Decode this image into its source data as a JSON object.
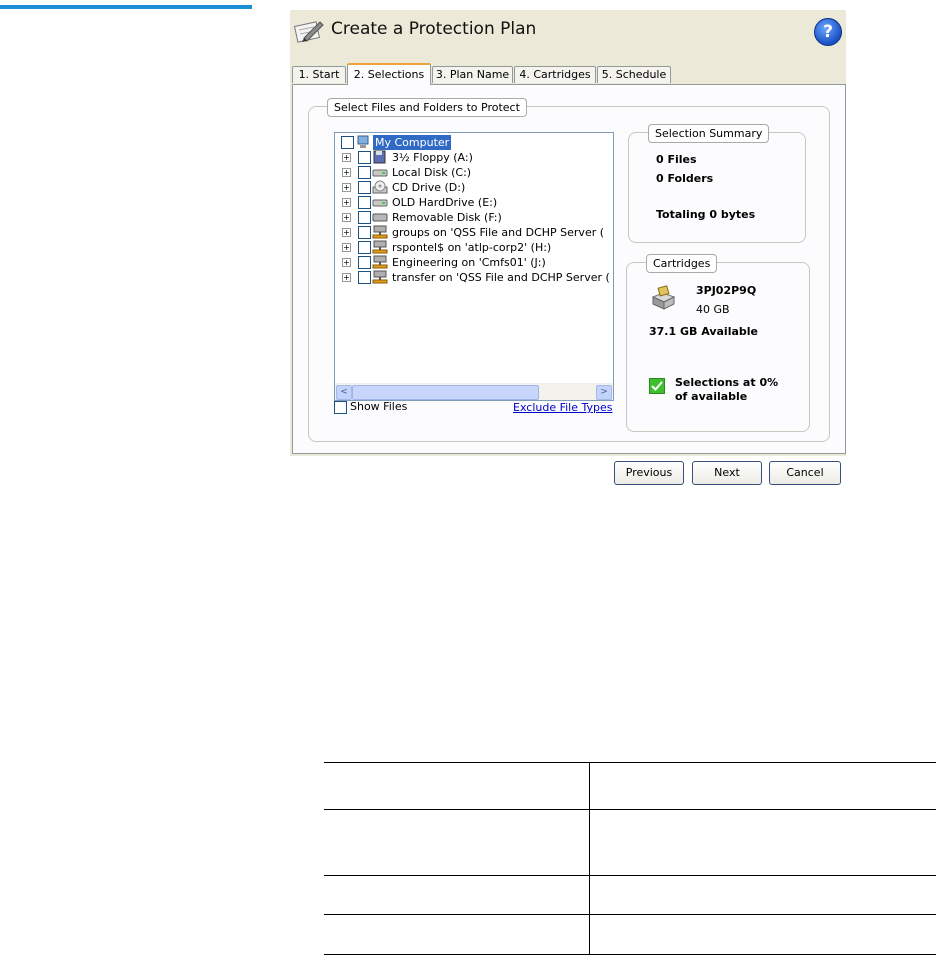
{
  "dialog": {
    "title": "Create a Protection Plan",
    "help_glyph": "?",
    "icons": {
      "title": "pencil-notepad-icon",
      "help": "help-icon"
    }
  },
  "tabs": [
    {
      "label": "1. Start",
      "active": false
    },
    {
      "label": "2. Selections",
      "active": true
    },
    {
      "label": "3. Plan Name",
      "active": false
    },
    {
      "label": "4. Cartridges",
      "active": false
    },
    {
      "label": "5. Schedule",
      "active": false
    }
  ],
  "selection_panel": {
    "group_label": "Select Files and Folders to Protect",
    "tree": [
      {
        "label": "My Computer",
        "icon": "my-computer-icon",
        "selected": true,
        "root": true
      },
      {
        "label": "3½ Floppy (A:)",
        "icon": "floppy-drive-icon"
      },
      {
        "label": "Local Disk (C:)",
        "icon": "hard-disk-icon"
      },
      {
        "label": "CD Drive (D:)",
        "icon": "cd-drive-icon"
      },
      {
        "label": "OLD HardDrive (E:)",
        "icon": "hard-disk-icon"
      },
      {
        "label": "Removable Disk (F:)",
        "icon": "removable-disk-icon"
      },
      {
        "label": "groups on 'QSS File and DCHP Server (",
        "icon": "network-drive-icon"
      },
      {
        "label": "rspontel$ on 'atlp-corp2' (H:)",
        "icon": "network-drive-icon"
      },
      {
        "label": "Engineering on 'Cmfs01' (J:)",
        "icon": "network-drive-icon"
      },
      {
        "label": "transfer on 'QSS File and DCHP Server (",
        "icon": "network-drive-icon"
      }
    ],
    "show_files_label": "Show Files",
    "exclude_link": "Exclude File Types",
    "scroll_left": "<",
    "scroll_right": ">"
  },
  "summary": {
    "group_label": "Selection Summary",
    "files": "0 Files",
    "folders": "0 Folders",
    "total": "Totaling 0 bytes"
  },
  "cartridges": {
    "group_label": "Cartridges",
    "name": "3PJ02P9Q",
    "size": "40 GB",
    "available": "37.1 GB Available",
    "status_line1": "Selections at 0%",
    "status_line2": "of available",
    "status_color": "#3fbf2f",
    "icons": {
      "cartridge": "cartridge-drive-icon",
      "status": "check-icon"
    }
  },
  "buttons": {
    "previous": "Previous",
    "next": "Next",
    "cancel": "Cancel"
  },
  "accent_color": "#1a8fd6"
}
